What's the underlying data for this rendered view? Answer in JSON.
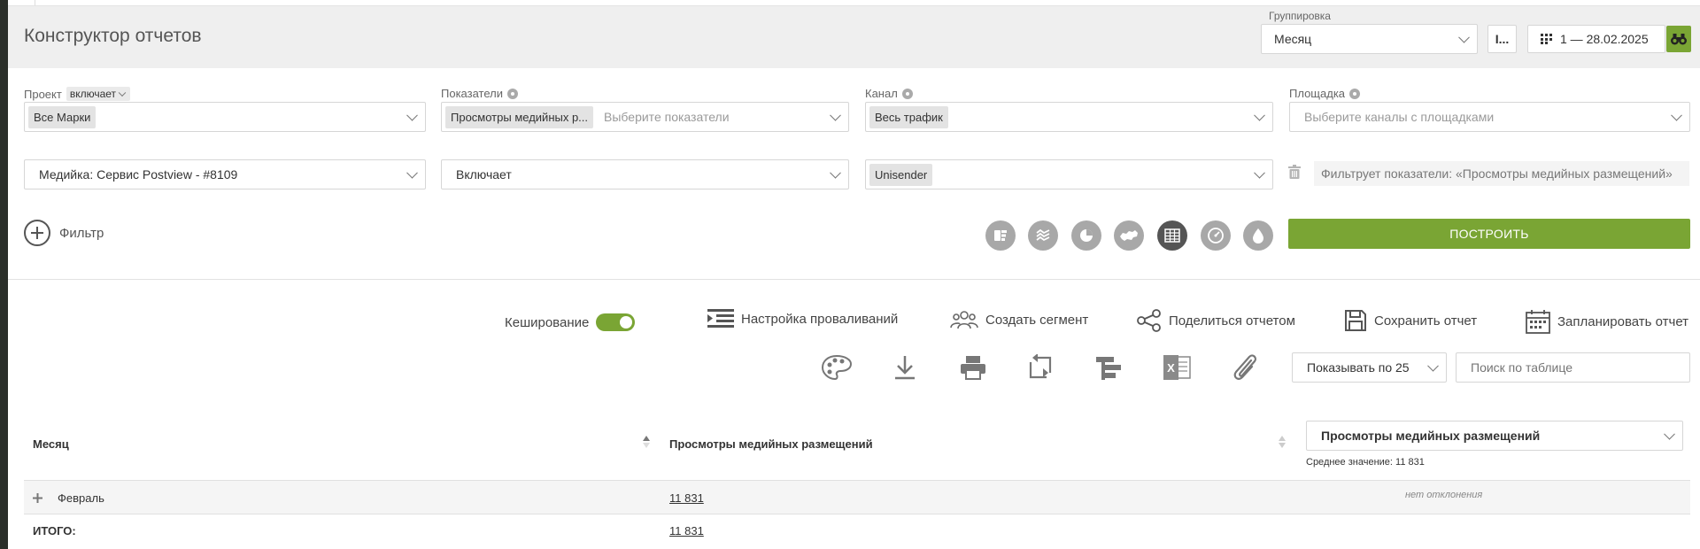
{
  "header": {
    "title": "Конструктор отчетов",
    "grouping_label": "Группировка",
    "grouping_value": "Месяц",
    "compare_button": "I...",
    "date_range": "1 — 28.02.2025"
  },
  "filters": {
    "project": {
      "label": "Проект",
      "mode": "включает",
      "value": "Все Марки"
    },
    "metrics": {
      "label": "Показатели",
      "value": "Просмотры медийных р...",
      "placeholder": "Выберите показатели"
    },
    "channel": {
      "label": "Канал",
      "value": "Весь трафик"
    },
    "platform": {
      "label": "Площадка",
      "placeholder": "Выберите каналы с площадками"
    },
    "extra": {
      "dimension": "Медийка: Сервис Postview - #8109",
      "operator": "Включает",
      "value": "Unisender",
      "note": "Фильтрует показатели: «Просмотры медийных размещений»"
    },
    "add_filter_label": "Фильтр"
  },
  "chart_types": [
    {
      "name": "funnel-chart-icon",
      "active": false
    },
    {
      "name": "area-chart-icon",
      "active": false
    },
    {
      "name": "pie-chart-icon",
      "active": false
    },
    {
      "name": "map-chart-icon",
      "active": false
    },
    {
      "name": "table-chart-icon",
      "active": true
    },
    {
      "name": "gauge-chart-icon",
      "active": false
    },
    {
      "name": "drop-chart-icon",
      "active": false
    }
  ],
  "build_button": "ПОСТРОИТЬ",
  "toolbar": {
    "caching_label": "Кеширование",
    "caching_on": true,
    "drilldown_label": "Настройка проваливаний",
    "segment_label": "Создать сегмент",
    "share_label": "Поделиться отчетом",
    "save_label": "Сохранить отчет",
    "schedule_label": "Запланировать отчет",
    "page_size": "Показывать по 25",
    "search_placeholder": "Поиск по таблице"
  },
  "table": {
    "col_month": "Месяц",
    "col_metric": "Просмотры медийных размещений",
    "metric_select": "Просмотры медийных размещений",
    "average": "Среднее значение: 11 831",
    "rows": [
      {
        "month": "Февраль",
        "value": "11 831",
        "deviation": "нет отклонения"
      }
    ],
    "total_label": "ИТОГО:",
    "total_value": "11 831"
  },
  "colors": {
    "accent": "#7aa534",
    "icon_gray": "#a8a8a8",
    "icon_active": "#555555"
  }
}
